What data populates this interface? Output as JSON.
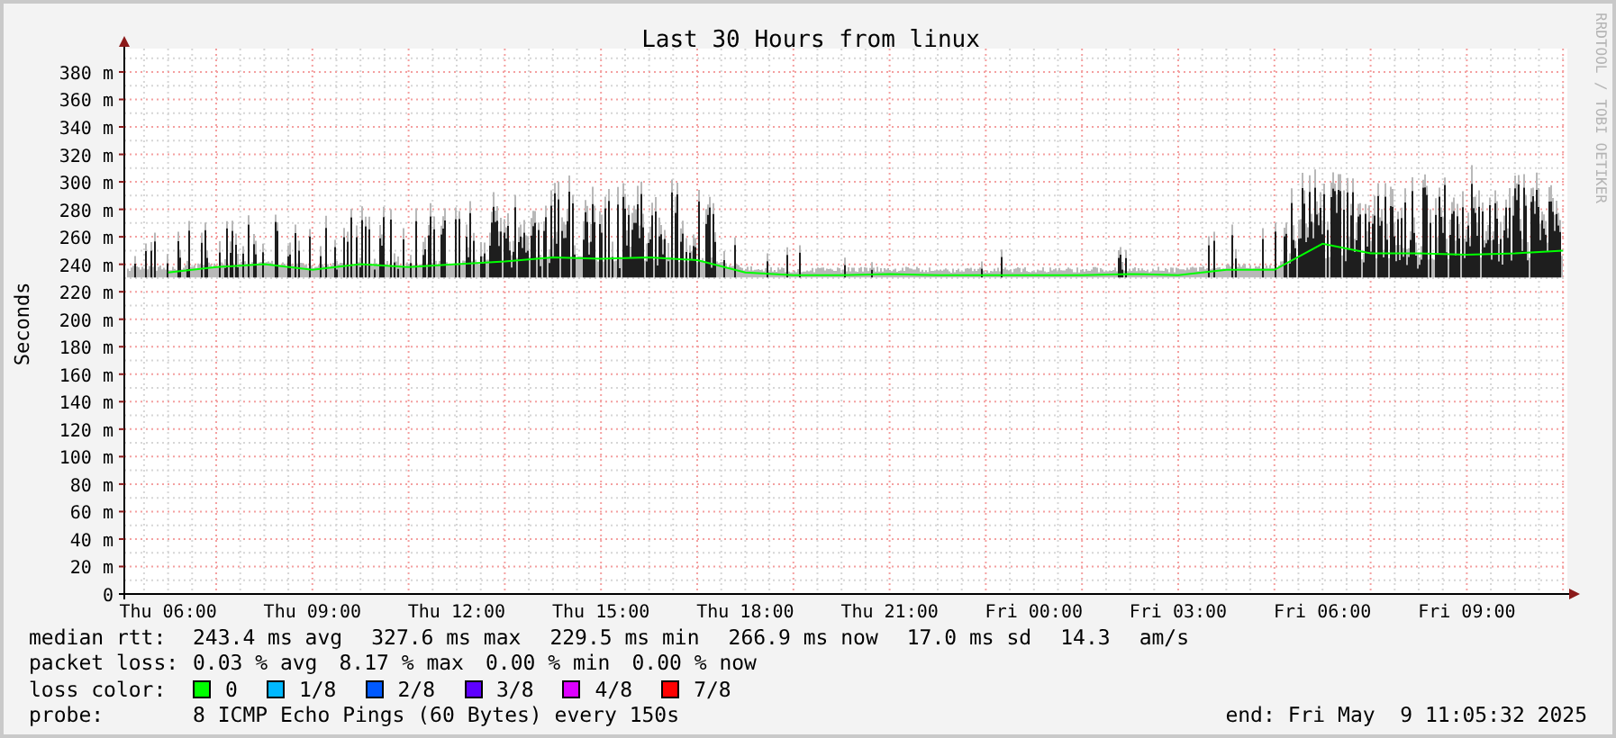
{
  "chart": {
    "credit": "RRDTOOL / TOBI OETIKER",
    "chart_data": {
      "type": "line",
      "grid": true,
      "title": "Last 30 Hours from linux",
      "ylabel": "Seconds",
      "ylim": [
        0,
        397
      ],
      "categories": [
        "Thu 06:00",
        null,
        null,
        "Thu 09:00",
        null,
        null,
        "Thu 12:00",
        null,
        null,
        "Thu 15:00",
        null,
        null,
        "Thu 18:00",
        null,
        null,
        "Thu 21:00",
        null,
        null,
        "Fri 00:00",
        null,
        null,
        "Fri 03:00",
        null,
        null,
        "Fri 06:00",
        null,
        null,
        "Fri 09:00",
        null,
        null
      ],
      "yticks": [
        {
          "value": 0,
          "label": "0"
        },
        {
          "value": 20,
          "label": "20 m"
        },
        {
          "value": 40,
          "label": "40 m"
        },
        {
          "value": 60,
          "label": "60 m"
        },
        {
          "value": 80,
          "label": "80 m"
        },
        {
          "value": 100,
          "label": "100 m"
        },
        {
          "value": 120,
          "label": "120 m"
        },
        {
          "value": 140,
          "label": "140 m"
        },
        {
          "value": 160,
          "label": "160 m"
        },
        {
          "value": 180,
          "label": "180 m"
        },
        {
          "value": 200,
          "label": "200 m"
        },
        {
          "value": 220,
          "label": "220 m"
        },
        {
          "value": 240,
          "label": "240 m"
        },
        {
          "value": 260,
          "label": "260 m"
        },
        {
          "value": 280,
          "label": "280 m"
        },
        {
          "value": 300,
          "label": "300 m"
        },
        {
          "value": 320,
          "label": "320 m"
        },
        {
          "value": 340,
          "label": "340 m"
        },
        {
          "value": 360,
          "label": "360 m"
        },
        {
          "value": 380,
          "label": "380 m"
        }
      ],
      "series": [
        {
          "color": "#00ff00",
          "values": [
            234,
            238,
            240,
            236,
            240,
            238,
            240,
            242,
            245,
            244,
            245,
            243,
            234,
            232,
            232,
            233,
            232,
            232,
            232,
            232,
            233,
            232,
            236,
            236,
            255,
            248,
            248,
            247,
            248,
            250
          ]
        }
      ]
    }
  },
  "legend": {
    "median_rtt": {
      "label": "median rtt:",
      "values": [
        "243.4 ms avg",
        "327.6 ms max",
        "229.5 ms min",
        "266.9 ms now",
        "17.0 ms sd",
        "14.3",
        "am/s"
      ]
    },
    "packet_loss": {
      "label": "packet loss:",
      "values": [
        "0.03 % avg",
        "8.17 % max",
        "0.00 % min",
        "0.00 % now"
      ]
    },
    "loss_color": {
      "label": "loss color:",
      "items": [
        {
          "label": "0",
          "color": "#00ff00"
        },
        {
          "label": "1/8",
          "color": "#00b8ff"
        },
        {
          "label": "2/8",
          "color": "#0059ff"
        },
        {
          "label": "3/8",
          "color": "#5e00ff"
        },
        {
          "label": "4/8",
          "color": "#dd00ff"
        },
        {
          "label": "7/8",
          "color": "#ff0000"
        }
      ]
    },
    "probe": {
      "label": "probe:",
      "text": "8 ICMP Echo Pings (60 Bytes) every 150s"
    },
    "end": "end: Fri May  9 11:05:32 2025"
  }
}
